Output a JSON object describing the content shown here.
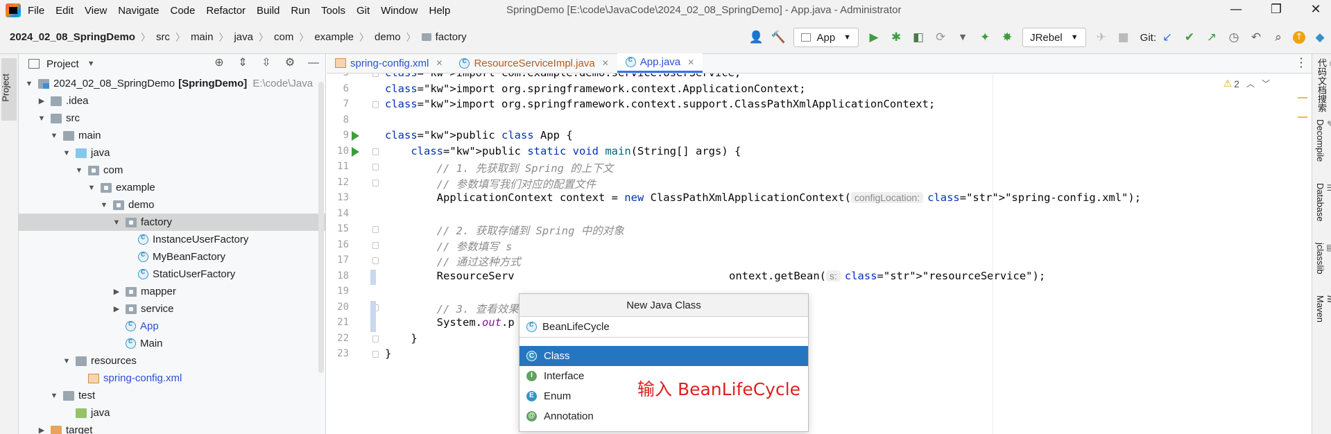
{
  "menu": [
    "File",
    "Edit",
    "View",
    "Navigate",
    "Code",
    "Refactor",
    "Build",
    "Run",
    "Tools",
    "Git",
    "Window",
    "Help"
  ],
  "window_title": "SpringDemo [E:\\code\\JavaCode\\2024_02_08_SpringDemo] - App.java - Administrator",
  "window_controls": {
    "minimize": "—",
    "maximize": "❐",
    "close": "✕"
  },
  "breadcrumb": [
    "2024_02_08_SpringDemo",
    "src",
    "main",
    "java",
    "com",
    "example",
    "demo",
    "factory"
  ],
  "toolbar": {
    "run_config": "App",
    "jrebel": "JRebel",
    "git_label": "Git:"
  },
  "left_strip": {
    "project_tab": "Project"
  },
  "project_panel": {
    "title": "Project",
    "tree": [
      {
        "label": "2024_02_08_SpringDemo",
        "suffix": "[SpringDemo]",
        "path": "E:\\code\\Java",
        "depth": 0,
        "arrow": "down",
        "icon": "module"
      },
      {
        "label": ".idea",
        "depth": 1,
        "arrow": "right",
        "icon": "folder"
      },
      {
        "label": "src",
        "depth": 1,
        "arrow": "down",
        "icon": "folder"
      },
      {
        "label": "main",
        "depth": 2,
        "arrow": "down",
        "icon": "folder"
      },
      {
        "label": "java",
        "depth": 3,
        "arrow": "down",
        "icon": "folder-blue"
      },
      {
        "label": "com",
        "depth": 4,
        "arrow": "down",
        "icon": "folder-pkg"
      },
      {
        "label": "example",
        "depth": 5,
        "arrow": "down",
        "icon": "folder-pkg"
      },
      {
        "label": "demo",
        "depth": 6,
        "arrow": "down",
        "icon": "folder-pkg"
      },
      {
        "label": "factory",
        "depth": 7,
        "arrow": "down",
        "icon": "folder-pkg",
        "selected": true
      },
      {
        "label": "InstanceUserFactory",
        "depth": 8,
        "arrow": "none",
        "icon": "cls"
      },
      {
        "label": "MyBeanFactory",
        "depth": 8,
        "arrow": "none",
        "icon": "cls"
      },
      {
        "label": "StaticUserFactory",
        "depth": 8,
        "arrow": "none",
        "icon": "cls"
      },
      {
        "label": "mapper",
        "depth": 7,
        "arrow": "right",
        "icon": "folder-pkg"
      },
      {
        "label": "service",
        "depth": 7,
        "arrow": "right",
        "icon": "folder-pkg"
      },
      {
        "label": "App",
        "depth": 7,
        "arrow": "none",
        "icon": "cls",
        "blue": true
      },
      {
        "label": "Main",
        "depth": 7,
        "arrow": "none",
        "icon": "cls"
      },
      {
        "label": "resources",
        "depth": 3,
        "arrow": "down",
        "icon": "folder"
      },
      {
        "label": "spring-config.xml",
        "depth": 4,
        "arrow": "none",
        "icon": "xml",
        "blue": true
      },
      {
        "label": "test",
        "depth": 2,
        "arrow": "down",
        "icon": "folder"
      },
      {
        "label": "java",
        "depth": 3,
        "arrow": "none",
        "icon": "folder-green"
      },
      {
        "label": "target",
        "depth": 1,
        "arrow": "right",
        "icon": "folder-orange"
      }
    ]
  },
  "tabs": [
    {
      "label": "spring-config.xml",
      "kind": "xml"
    },
    {
      "label": "ResourceServiceImpl.java",
      "kind": "impl"
    },
    {
      "label": "App.java",
      "kind": "app",
      "active": true
    }
  ],
  "editor": {
    "warnings": "2",
    "lines": [
      {
        "n": "5",
        "code": "import com.example.demo.service.UserService;"
      },
      {
        "n": "6",
        "code": "import org.springframework.context.ApplicationContext;"
      },
      {
        "n": "7",
        "code": "import org.springframework.context.support.ClassPathXmlApplicationContext;"
      },
      {
        "n": "8",
        "code": ""
      },
      {
        "n": "9",
        "code": "public class App {"
      },
      {
        "n": "10",
        "code": "    public static void main(String[] args) {"
      },
      {
        "n": "11",
        "code": "        // 1. 先获取到 Spring 的上下文"
      },
      {
        "n": "12",
        "code": "        // 参数填写我们对应的配置文件"
      },
      {
        "n": "13",
        "code": "        ApplicationContext context = new ClassPathXmlApplicationContext(",
        "hint": "configLocation:",
        "tail": "\"spring-config.xml\");"
      },
      {
        "n": "14",
        "code": ""
      },
      {
        "n": "15",
        "code": "        // 2. 获取存储到 Spring 中的对象"
      },
      {
        "n": "16",
        "code": "        // 参数填写 s"
      },
      {
        "n": "17",
        "code": "        // 通过这种方式"
      },
      {
        "n": "18",
        "code": "        ResourceServ",
        "tail2": "ontext.getBean(",
        "hint2": "s:",
        "tail3": "\"resourceService\");"
      },
      {
        "n": "19",
        "code": ""
      },
      {
        "n": "20",
        "code": "        // 3. 查看效果"
      },
      {
        "n": "21",
        "code": "        System.out.p"
      },
      {
        "n": "22",
        "code": "    }"
      },
      {
        "n": "23",
        "code": "}"
      }
    ]
  },
  "right_strip": [
    "代码文档搜索",
    "Decompile",
    "Database",
    "jclasslib",
    "Maven"
  ],
  "popup": {
    "title": "New Java Class",
    "input_value": "BeanLifeCycle",
    "kinds": [
      {
        "label": "Class",
        "badge": "C",
        "color": "#3592c4",
        "selected": true
      },
      {
        "label": "Interface",
        "badge": "I",
        "color": "#5fa35f"
      },
      {
        "label": "Enum",
        "badge": "E",
        "color": "#3592c4"
      },
      {
        "label": "Annotation",
        "badge": "@",
        "color": "#5fa35f"
      }
    ],
    "annotation": "输入 BeanLifeCycle"
  }
}
